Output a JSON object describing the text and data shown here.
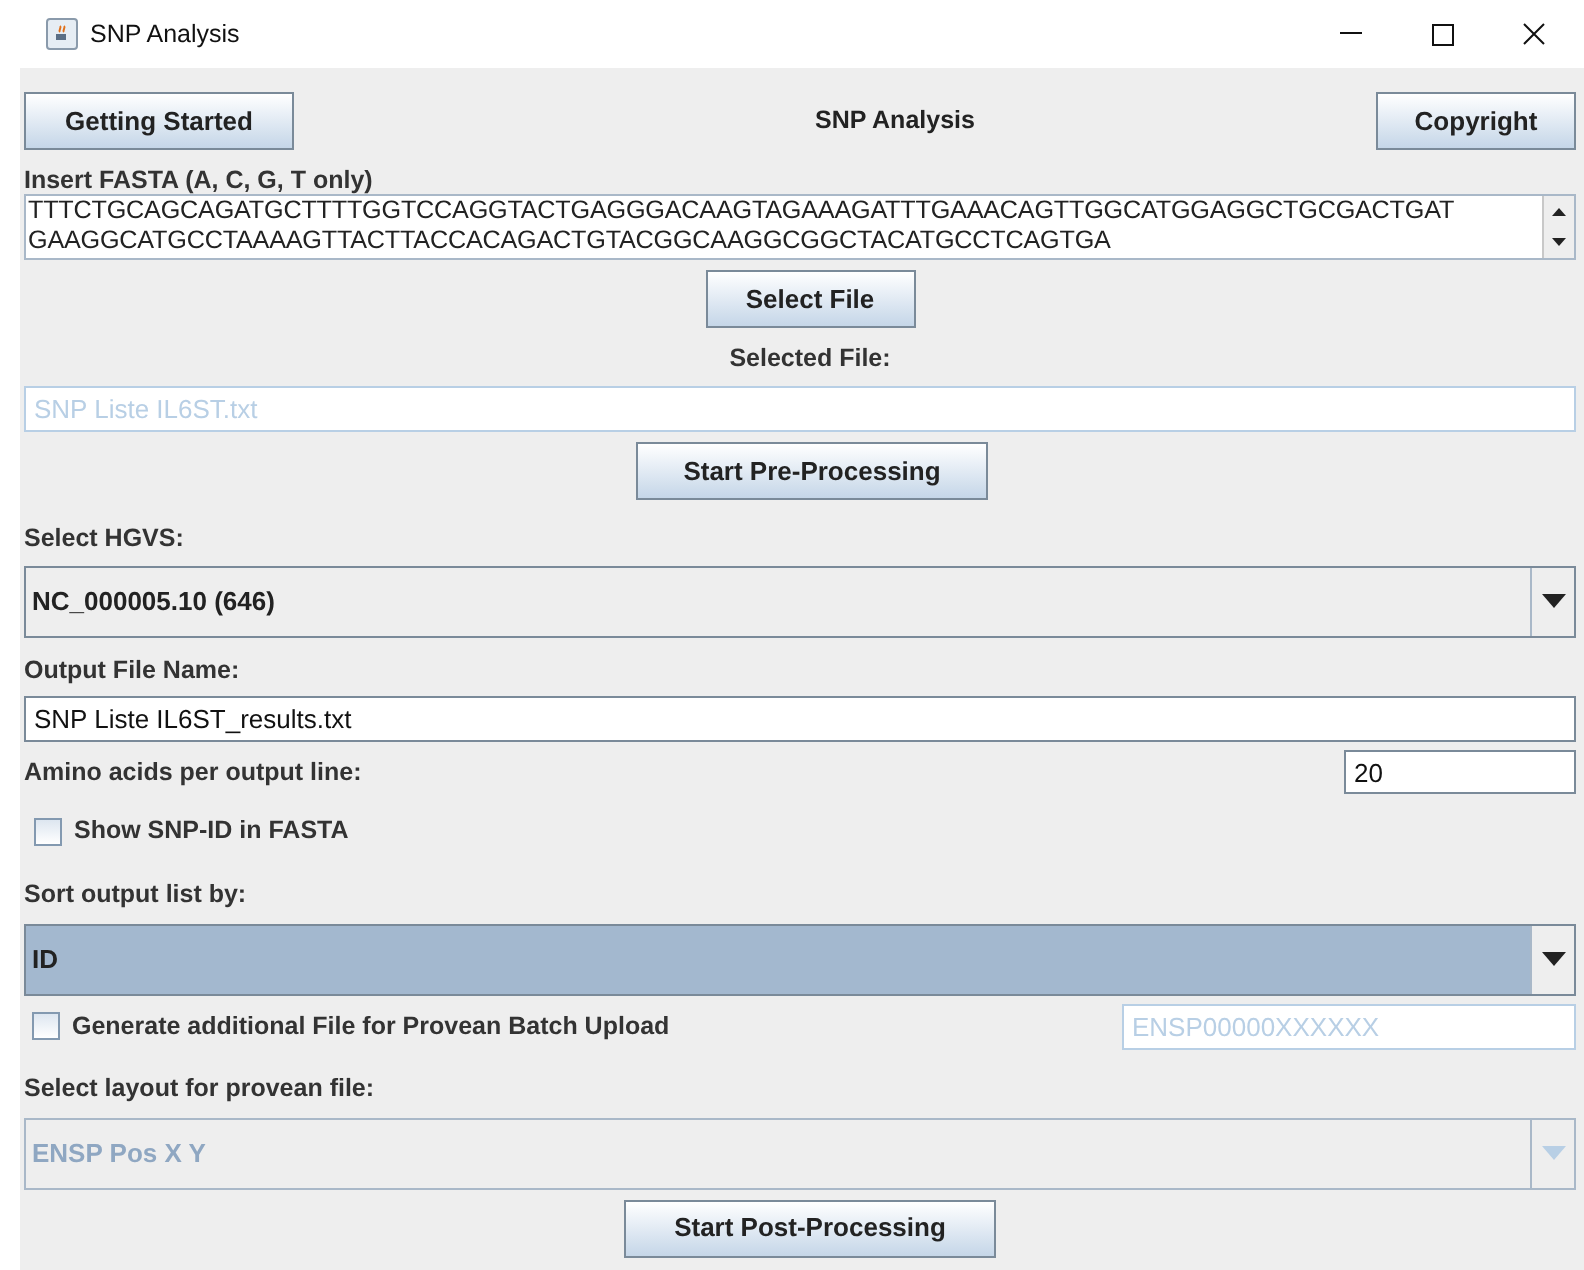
{
  "window": {
    "title": "SNP Analysis"
  },
  "header": {
    "left_button": "Getting Started",
    "title": "SNP Analysis",
    "right_button": "Copyright"
  },
  "fasta": {
    "label": "Insert FASTA (A, C, G, T only)",
    "lines": [
      "TTTCTGCAGCAGATGCTTTTGGTCCAGGTACTGAGGGACAAGTAGAAAGATTTGAAACAGTTGGCATGGAGGCTGCGACTGAT",
      "GAAGGCATGCCTAAAAGTTACTTACCACAGACTGTACGGCAAGGCGGCTACATGCCTCAGTGA"
    ]
  },
  "select_file_button": "Select File",
  "selected_file": {
    "label": "Selected File:",
    "value": "SNP Liste IL6ST.txt",
    "disabled": true
  },
  "preprocess_button": "Start Pre-Processing",
  "hgvs": {
    "label": "Select HGVS:",
    "value": "NC_000005.10 (646)",
    "highlighted": false,
    "disabled": false
  },
  "output_file": {
    "label": "Output File Name:",
    "value": "SNP Liste IL6ST_results.txt",
    "disabled": false
  },
  "amino_acids": {
    "label": "Amino acids per output line:",
    "value": "20"
  },
  "show_snp_id": {
    "label": "Show SNP-ID in FASTA",
    "checked": false
  },
  "sort": {
    "label": "Sort output list by:",
    "value": "ID",
    "highlighted": true,
    "disabled": false
  },
  "provean": {
    "label": "Generate additional File for Provean Batch Upload",
    "checked": false,
    "protein_id": {
      "value": "ENSP00000XXXXXX",
      "disabled": true
    }
  },
  "layout": {
    "label": "Select layout for provean file:",
    "value": "ENSP Pos X Y",
    "highlighted": false,
    "disabled": true
  },
  "postprocess_button": "Start Post-Processing"
}
